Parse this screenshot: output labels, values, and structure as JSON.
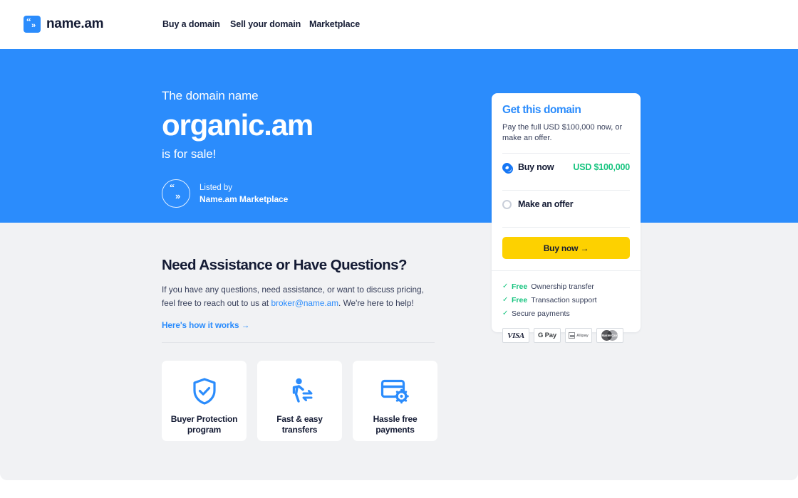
{
  "colors": {
    "brand_blue": "#2b8cfc",
    "accent_yellow": "#fdd100",
    "green": "#16c47f",
    "dark": "#141b34",
    "page_grey": "#f1f2f4"
  },
  "header": {
    "brand_name": "name.am",
    "logo_quote": "“",
    "logo_chevron": "»",
    "nav": [
      {
        "label": "Buy a domain"
      },
      {
        "label": "Sell your domain"
      },
      {
        "label": "Marketplace"
      }
    ]
  },
  "hero": {
    "kicker": "The domain name",
    "domain": "organic.am",
    "subtitle": "is for sale!",
    "badge_quote": "“",
    "badge_chevron": "»",
    "listed_by_label": "Listed by",
    "listed_by_value": "Name.am Marketplace"
  },
  "assistance": {
    "heading": "Need Assistance or Have Questions?",
    "body_before": "If you have any questions, need assistance, or want to discuss pricing, feel free to reach out to us at ",
    "email": "broker@name.am",
    "body_after": ". We're here to help!",
    "link": "Here's how it works →"
  },
  "features": [
    {
      "icon": "shield-check-icon",
      "label": "Buyer Protection\nprogram"
    },
    {
      "icon": "person-transfer-icon",
      "label": "Fast & easy\ntransfers"
    },
    {
      "icon": "card-gear-icon",
      "label": "Hassle free\npayments"
    }
  ],
  "buy_card": {
    "title": "Get this domain",
    "description": "Pay the full USD $100,000 now, or make an offer.",
    "options": [
      {
        "label": "Buy now",
        "price": "USD $100,000",
        "selected": true
      },
      {
        "label": "Make an offer",
        "price": "",
        "selected": false
      }
    ],
    "cta": "Buy now →",
    "perks": [
      {
        "tick": "✓",
        "free": "Free",
        "text": "Ownership transfer"
      },
      {
        "tick": "✓",
        "free": "Free",
        "text": "Transaction support"
      },
      {
        "tick": "✓",
        "free": "",
        "text": "Secure payments"
      }
    ],
    "payments": [
      {
        "name": "visa-logo",
        "label": "VISA"
      },
      {
        "name": "google-pay-logo",
        "label": "G Pay"
      },
      {
        "name": "alipay-logo",
        "label": "Alipay"
      },
      {
        "name": "mastercard-logo",
        "label": "MasterCard"
      }
    ]
  }
}
